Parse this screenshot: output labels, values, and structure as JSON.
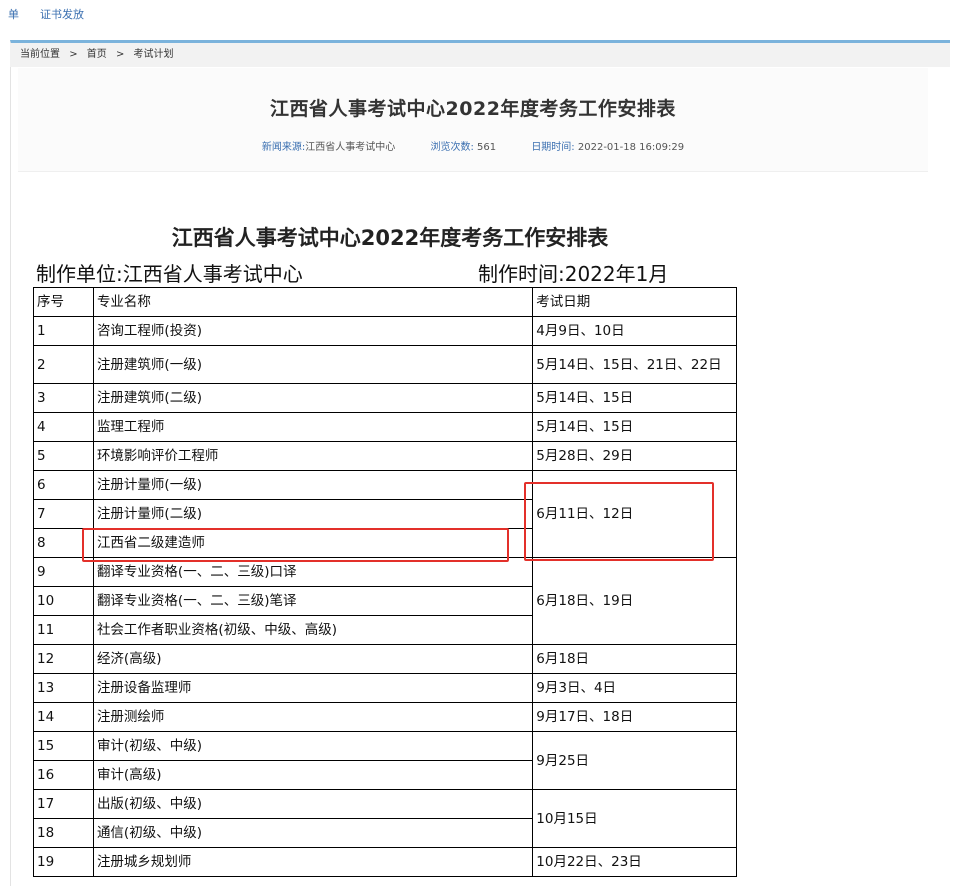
{
  "topnav": {
    "item_a": "单",
    "item_b": "证书发放"
  },
  "breadcrumb": {
    "current_label": "当前位置",
    "sep": ">",
    "home": "首页",
    "section": "考试计划"
  },
  "article": {
    "title": "江西省人事考试中心2022年度考务工作安排表",
    "source_label": "新闻来源:",
    "source_value": "江西省人事考试中心",
    "views_label": "浏览次数:",
    "views_value": "561",
    "date_label": "日期时间:",
    "date_value": "2022-01-18 16:09:29"
  },
  "document": {
    "title": "江西省人事考试中心2022年度考务工作安排表",
    "maker": "制作单位:江西省人事考试中心",
    "made_time": "制作时间:2022年1月"
  },
  "table": {
    "headers": [
      "序号",
      "专业名称",
      "考试日期"
    ],
    "rows": [
      {
        "no": "1",
        "name": "咨询工程师(投资)",
        "date": "4月9日、10日"
      },
      {
        "no": "2",
        "name": "注册建筑师(一级)",
        "date": "5月14日、15日、21日、22日"
      },
      {
        "no": "3",
        "name": "注册建筑师(二级)",
        "date": "5月14日、15日"
      },
      {
        "no": "4",
        "name": "监理工程师",
        "date": "5月14日、15日"
      },
      {
        "no": "5",
        "name": "环境影响评价工程师",
        "date": "5月28日、29日"
      },
      {
        "no": "6",
        "name": "注册计量师(一级)",
        "date": "6月11日、12日"
      },
      {
        "no": "7",
        "name": "注册计量师(二级)",
        "date": ""
      },
      {
        "no": "8",
        "name": "江西省二级建造师",
        "date": ""
      },
      {
        "no": "9",
        "name": "翻译专业资格(一、二、三级)口译",
        "date": "6月18日、19日"
      },
      {
        "no": "10",
        "name": "翻译专业资格(一、二、三级)笔译",
        "date": ""
      },
      {
        "no": "11",
        "name": "社会工作者职业资格(初级、中级、高级)",
        "date": ""
      },
      {
        "no": "12",
        "name": "经济(高级)",
        "date": "6月18日"
      },
      {
        "no": "13",
        "name": "注册设备监理师",
        "date": "9月3日、4日"
      },
      {
        "no": "14",
        "name": "注册测绘师",
        "date": "9月17日、18日"
      },
      {
        "no": "15",
        "name": "审计(初级、中级)",
        "date": "9月25日"
      },
      {
        "no": "16",
        "name": "审计(高级)",
        "date": ""
      },
      {
        "no": "17",
        "name": "出版(初级、中级)",
        "date": "10月15日"
      },
      {
        "no": "18",
        "name": "通信(初级、中级)",
        "date": ""
      },
      {
        "no": "19",
        "name": "注册城乡规划师",
        "date": "10月22日、23日"
      }
    ]
  },
  "highlight": {
    "color": "#e3302a"
  }
}
